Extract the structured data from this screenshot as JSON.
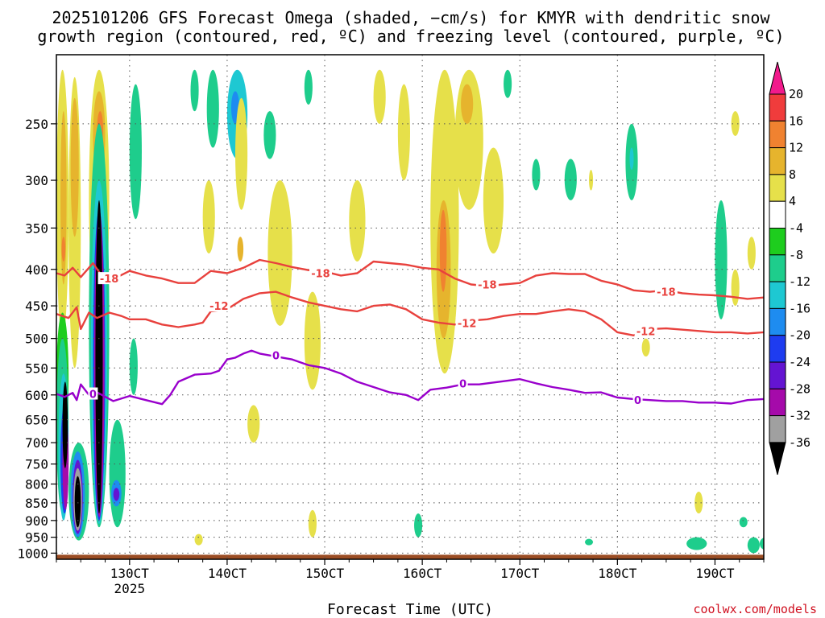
{
  "title_line1": "2025101206 GFS Forecast Omega (shaded, −cm/s) for KMYR with dendritic snow",
  "title_line2": "growth region (contoured, red, ºC) and freezing level (contoured, purple, ºC)",
  "credit": "coolwx.com/models",
  "colors": {
    "ground": "#9b4d24",
    "contour_red": "#e8413d",
    "contour_purple": "#9900cc",
    "grid": "#555555"
  },
  "chart_data": {
    "type": "heatmap",
    "xlabel": "Forecast Time (UTC)",
    "ylabel": "",
    "y_scale": "log-pressure, inverted",
    "yticks": [
      250,
      300,
      350,
      400,
      450,
      500,
      550,
      600,
      650,
      700,
      750,
      800,
      850,
      900,
      950,
      1000
    ],
    "ylim": [
      200,
      1020
    ],
    "xlim_hours": [
      0,
      174
    ],
    "x_tick_labels": [
      "130CT",
      "140CT",
      "150CT",
      "160CT",
      "170CT",
      "180CT",
      "190CT"
    ],
    "x_tick_hours": [
      18,
      42,
      66,
      90,
      114,
      138,
      162
    ],
    "x_year_label": "2025",
    "grid": true,
    "colorbar": {
      "unit": "-cm/s",
      "labels": [
        "20",
        "16",
        "12",
        "8",
        "4",
        "-4",
        "-8",
        "-12",
        "-16",
        "-20",
        "-24",
        "-28",
        "-32",
        "-36"
      ],
      "colors": [
        "#f21a8c",
        "#f03c3c",
        "#f08230",
        "#e6b42d",
        "#e6e04a",
        "#ffffff",
        "#1ecd1e",
        "#1ecd8c",
        "#1ec8d2",
        "#1e8cf0",
        "#1e3cf0",
        "#6414d2",
        "#a50aaa",
        "#a0a0a0",
        "#000000"
      ]
    },
    "contours": [
      {
        "name": "-18",
        "color": "#e8413d",
        "x": [
          0,
          2,
          4,
          6,
          9,
          12,
          15,
          18,
          22,
          26,
          30,
          34,
          38,
          42,
          46,
          50,
          54,
          58,
          62,
          66,
          70,
          74,
          78,
          82,
          86,
          90,
          94,
          98,
          102,
          106,
          110,
          114,
          118,
          122,
          126,
          130,
          134,
          138,
          142,
          146,
          150,
          154,
          158,
          162,
          166,
          170,
          174
        ],
        "y": [
          405,
          408,
          398,
          410,
          392,
          415,
          410,
          402,
          408,
          412,
          418,
          418,
          402,
          405,
          398,
          388,
          392,
          397,
          401,
          403,
          408,
          405,
          390,
          392,
          394,
          398,
          400,
          412,
          420,
          422,
          420,
          418,
          408,
          405,
          406,
          406,
          415,
          420,
          428,
          430,
          428,
          432,
          434,
          435,
          437,
          440,
          438
        ]
      },
      {
        "name": "-12",
        "color": "#e8413d",
        "x": [
          0,
          3,
          5,
          6,
          8,
          10,
          13,
          16,
          18,
          22,
          26,
          30,
          34,
          36,
          38,
          42,
          46,
          50,
          54,
          58,
          62,
          66,
          70,
          74,
          78,
          82,
          86,
          90,
          94,
          98,
          102,
          106,
          110,
          114,
          118,
          122,
          126,
          130,
          134,
          138,
          142,
          146,
          150,
          154,
          158,
          162,
          166,
          170,
          174
        ],
        "y": [
          462,
          468,
          452,
          485,
          460,
          468,
          460,
          465,
          470,
          470,
          478,
          482,
          478,
          475,
          458,
          455,
          440,
          432,
          430,
          438,
          445,
          450,
          455,
          458,
          450,
          448,
          455,
          470,
          475,
          478,
          472,
          470,
          465,
          462,
          462,
          458,
          455,
          458,
          470,
          490,
          495,
          485,
          484,
          486,
          488,
          490,
          490,
          492,
          490
        ]
      },
      {
        "name": "0",
        "color": "#9900cc",
        "x": [
          0,
          2,
          4,
          5,
          6,
          8,
          10,
          14,
          18,
          22,
          26,
          28,
          30,
          34,
          38,
          40,
          42,
          44,
          46,
          48,
          50,
          54,
          58,
          62,
          66,
          70,
          74,
          78,
          82,
          86,
          89,
          92,
          96,
          100,
          104,
          108,
          112,
          114,
          118,
          122,
          126,
          130,
          134,
          138,
          142,
          146,
          150,
          154,
          158,
          162,
          166,
          170,
          174
        ],
        "y": [
          598,
          604,
          596,
          610,
          580,
          600,
          595,
          612,
          602,
          610,
          618,
          600,
          575,
          562,
          560,
          555,
          535,
          532,
          525,
          520,
          525,
          530,
          535,
          545,
          550,
          560,
          575,
          585,
          595,
          600,
          610,
          590,
          586,
          580,
          580,
          576,
          572,
          570,
          578,
          585,
          590,
          596,
          595,
          605,
          608,
          610,
          612,
          612,
          615,
          615,
          617,
          610,
          608
        ]
      }
    ],
    "contour_labels": [
      {
        "text": "-18",
        "x": 13,
        "y": 412,
        "series": "-18"
      },
      {
        "text": "-12",
        "x": 40,
        "y": 450,
        "series": "-12"
      },
      {
        "text": "-18",
        "x": 65,
        "y": 405,
        "series": "-18"
      },
      {
        "text": "0",
        "x": 9,
        "y": 598,
        "series": "0"
      },
      {
        "text": "0",
        "x": 54,
        "y": 528,
        "series": "0"
      },
      {
        "text": "-18",
        "x": 106,
        "y": 420,
        "series": "-18"
      },
      {
        "text": "-12",
        "x": 101,
        "y": 476,
        "series": "-12"
      },
      {
        "text": "0",
        "x": 100,
        "y": 578,
        "series": "0"
      },
      {
        "text": "-18",
        "x": 150,
        "y": 430,
        "series": "-18"
      },
      {
        "text": "-12",
        "x": 145,
        "y": 488,
        "series": "-12"
      },
      {
        "text": "0",
        "x": 143,
        "y": 610,
        "series": "0"
      }
    ],
    "omega_blobs": [
      {
        "value": 4,
        "x": [
          0,
          3
        ],
        "y": [
          210,
          500
        ]
      },
      {
        "value": 8,
        "x": [
          1,
          2.5
        ],
        "y": [
          240,
          420
        ]
      },
      {
        "value": 12,
        "x": [
          1.3,
          2.2
        ],
        "y": [
          360,
          390
        ]
      },
      {
        "value": 4,
        "x": [
          3,
          6
        ],
        "y": [
          215,
          550
        ]
      },
      {
        "value": 8,
        "x": [
          3.5,
          5.5
        ],
        "y": [
          230,
          360
        ]
      },
      {
        "value": 4,
        "x": [
          8,
          13
        ],
        "y": [
          210,
          480
        ]
      },
      {
        "value": 8,
        "x": [
          9,
          12
        ],
        "y": [
          225,
          300
        ]
      },
      {
        "value": 12,
        "x": [
          10,
          11.5
        ],
        "y": [
          240,
          270
        ]
      },
      {
        "value": -4,
        "x": [
          0,
          3
        ],
        "y": [
          460,
          700
        ]
      },
      {
        "value": -8,
        "x": [
          0,
          3
        ],
        "y": [
          500,
          880
        ]
      },
      {
        "value": -12,
        "x": [
          0.5,
          3
        ],
        "y": [
          560,
          900
        ]
      },
      {
        "value": -20,
        "x": [
          1,
          3
        ],
        "y": [
          620,
          880
        ]
      },
      {
        "value": -28,
        "x": [
          1.5,
          3
        ],
        "y": [
          640,
          870
        ]
      },
      {
        "value": -36,
        "x": [
          1.5,
          2.8
        ],
        "y": [
          575,
          760
        ]
      },
      {
        "value": -8,
        "x": [
          3,
          8
        ],
        "y": [
          700,
          960
        ]
      },
      {
        "value": -16,
        "x": [
          3.5,
          7
        ],
        "y": [
          720,
          950
        ]
      },
      {
        "value": -24,
        "x": [
          4,
          6.5
        ],
        "y": [
          740,
          940
        ]
      },
      {
        "value": -32,
        "x": [
          4.2,
          6.3
        ],
        "y": [
          760,
          930
        ]
      },
      {
        "value": -36,
        "x": [
          4.5,
          6
        ],
        "y": [
          780,
          920
        ]
      },
      {
        "value": -8,
        "x": [
          8,
          13
        ],
        "y": [
          250,
          920
        ]
      },
      {
        "value": -12,
        "x": [
          8.5,
          12.5
        ],
        "y": [
          300,
          910
        ]
      },
      {
        "value": -20,
        "x": [
          9,
          12
        ],
        "y": [
          330,
          900
        ]
      },
      {
        "value": -28,
        "x": [
          9.3,
          11.8
        ],
        "y": [
          330,
          890
        ]
      },
      {
        "value": -36,
        "x": [
          9.6,
          11.4
        ],
        "y": [
          320,
          880
        ]
      },
      {
        "value": -8,
        "x": [
          13,
          17
        ],
        "y": [
          650,
          920
        ]
      },
      {
        "value": -16,
        "x": [
          13.5,
          16
        ],
        "y": [
          790,
          860
        ]
      },
      {
        "value": -24,
        "x": [
          14,
          15.5
        ],
        "y": [
          810,
          845
        ]
      },
      {
        "value": -8,
        "x": [
          18,
          21
        ],
        "y": [
          220,
          340
        ]
      },
      {
        "value": -8,
        "x": [
          18,
          20
        ],
        "y": [
          500,
          600
        ]
      },
      {
        "value": -8,
        "x": [
          33,
          35
        ],
        "y": [
          210,
          240
        ]
      },
      {
        "value": -8,
        "x": [
          37,
          40
        ],
        "y": [
          210,
          270
        ]
      },
      {
        "value": -12,
        "x": [
          42,
          47
        ],
        "y": [
          210,
          280
        ]
      },
      {
        "value": -16,
        "x": [
          43,
          45
        ],
        "y": [
          225,
          250
        ]
      },
      {
        "value": -8,
        "x": [
          51,
          54
        ],
        "y": [
          240,
          280
        ]
      },
      {
        "value": -8,
        "x": [
          61,
          63
        ],
        "y": [
          210,
          235
        ]
      },
      {
        "value": 4,
        "x": [
          36,
          39
        ],
        "y": [
          300,
          380
        ]
      },
      {
        "value": 4,
        "x": [
          44,
          47
        ],
        "y": [
          230,
          330
        ]
      },
      {
        "value": 8,
        "x": [
          44.5,
          46
        ],
        "y": [
          360,
          390
        ]
      },
      {
        "value": 4,
        "x": [
          52,
          58
        ],
        "y": [
          300,
          480
        ]
      },
      {
        "value": 4,
        "x": [
          61,
          65
        ],
        "y": [
          430,
          590
        ]
      },
      {
        "value": 4,
        "x": [
          72,
          76
        ],
        "y": [
          300,
          390
        ]
      },
      {
        "value": 4,
        "x": [
          78,
          81
        ],
        "y": [
          210,
          250
        ]
      },
      {
        "value": 4,
        "x": [
          84,
          87
        ],
        "y": [
          220,
          300
        ]
      },
      {
        "value": 4,
        "x": [
          92,
          99
        ],
        "y": [
          210,
          560
        ]
      },
      {
        "value": 8,
        "x": [
          93.5,
          97
        ],
        "y": [
          320,
          500
        ]
      },
      {
        "value": 12,
        "x": [
          94.3,
          96
        ],
        "y": [
          330,
          430
        ]
      },
      {
        "value": 4,
        "x": [
          98,
          105
        ],
        "y": [
          210,
          330
        ]
      },
      {
        "value": 8,
        "x": [
          99.5,
          102.5
        ],
        "y": [
          220,
          250
        ]
      },
      {
        "value": 4,
        "x": [
          105,
          110
        ],
        "y": [
          270,
          380
        ]
      },
      {
        "value": 4,
        "x": [
          62,
          64
        ],
        "y": [
          870,
          950
        ]
      },
      {
        "value": 4,
        "x": [
          34,
          36
        ],
        "y": [
          940,
          975
        ]
      },
      {
        "value": 4,
        "x": [
          47,
          50
        ],
        "y": [
          620,
          700
        ]
      },
      {
        "value": 4,
        "x": [
          131,
          132
        ],
        "y": [
          290,
          310
        ]
      },
      {
        "value": 4,
        "x": [
          144,
          146
        ],
        "y": [
          500,
          530
        ]
      },
      {
        "value": 4,
        "x": [
          157,
          159
        ],
        "y": [
          820,
          880
        ]
      },
      {
        "value": 4,
        "x": [
          166,
          168
        ],
        "y": [
          240,
          260
        ]
      },
      {
        "value": 4,
        "x": [
          170,
          172
        ],
        "y": [
          360,
          400
        ]
      },
      {
        "value": 4,
        "x": [
          166,
          168
        ],
        "y": [
          400,
          450
        ]
      },
      {
        "value": -8,
        "x": [
          110,
          112
        ],
        "y": [
          210,
          230
        ]
      },
      {
        "value": -8,
        "x": [
          117,
          119
        ],
        "y": [
          280,
          310
        ]
      },
      {
        "value": -8,
        "x": [
          125,
          128
        ],
        "y": [
          280,
          320
        ]
      },
      {
        "value": -8,
        "x": [
          140,
          143
        ],
        "y": [
          250,
          320
        ]
      },
      {
        "value": -12,
        "x": [
          141,
          142
        ],
        "y": [
          270,
          290
        ]
      },
      {
        "value": -8,
        "x": [
          162,
          165
        ],
        "y": [
          320,
          470
        ]
      },
      {
        "value": -8,
        "x": [
          174,
          177
        ],
        "y": [
          210,
          240
        ]
      },
      {
        "value": -8,
        "x": [
          170,
          173
        ],
        "y": [
          950,
          1000
        ]
      },
      {
        "value": -8,
        "x": [
          88,
          90
        ],
        "y": [
          880,
          950
        ]
      },
      {
        "value": -8,
        "x": [
          130,
          132
        ],
        "y": [
          955,
          975
        ]
      },
      {
        "value": -8,
        "x": [
          155,
          160
        ],
        "y": [
          950,
          990
        ]
      },
      {
        "value": -8,
        "x": [
          168,
          170
        ],
        "y": [
          890,
          920
        ]
      },
      {
        "value": -8,
        "x": [
          173,
          176
        ],
        "y": [
          950,
          990
        ]
      }
    ]
  }
}
